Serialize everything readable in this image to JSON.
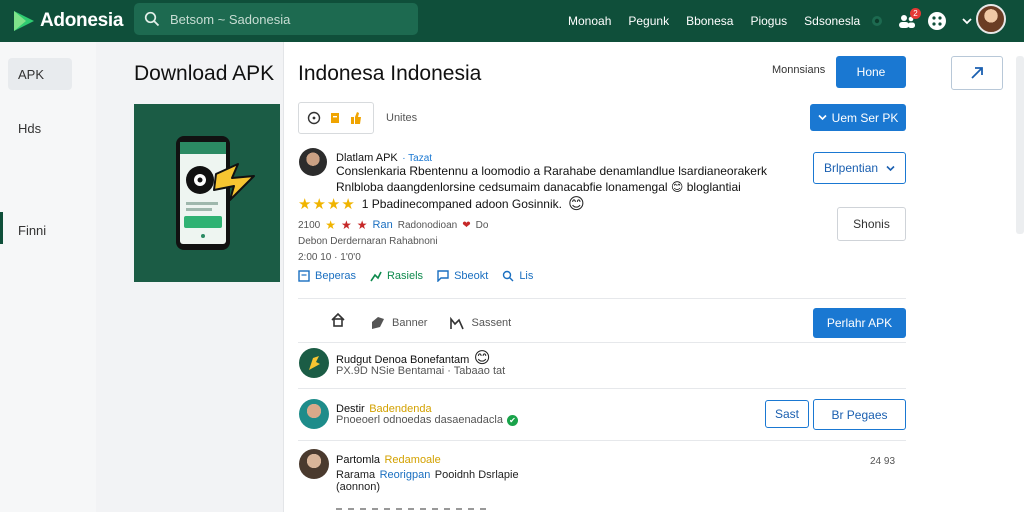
{
  "brand": {
    "name": "Adonesia"
  },
  "search": {
    "placeholder": "Betsom ~ Sadonesia"
  },
  "nav": {
    "links": [
      "Monoah",
      "Pegunk",
      "Bbonesa",
      "Piogus",
      "Sdsonesla"
    ]
  },
  "notifications": {
    "count": "2"
  },
  "rail": {
    "items": [
      "APK",
      "Hds",
      "Finni"
    ]
  },
  "download": {
    "title": "Download APK"
  },
  "panel": {
    "title": "Indonesa Indonesia",
    "header_label": "Monnsians",
    "header_button": "Hone",
    "toolbar_label": "Unites",
    "user_set_button": "Uem Ser PK"
  },
  "app_post": {
    "name": "Dlatlam APK",
    "tag": "Tazat",
    "line1": "Conslenkaria Rbentennu a loomodio a Rarahabe denamlandlue lsardianeorakerk",
    "line2": "Rnlbloba daangdenlorsine cedsumaim danacabfie lonamengal",
    "line2_emoji": "😊 ",
    "line2_tail": "bloglantiai",
    "rating_text": "1 Pbadinecompaned adoon Gosinnik.",
    "rating_emoji": "😊",
    "stats_line": "2100",
    "stats_label": "Ran",
    "stats_extra": "Radonodioan",
    "stats_tail": "Do",
    "meta1": "Debon Derdernaran Rahabnoni",
    "meta2": "2:00 10 · 1'0'0",
    "actions": [
      "Beperas",
      "Rasiels",
      "Sbeokt",
      "Lis"
    ],
    "dropdown": "Brlpentian",
    "side_button": "Shonis"
  },
  "action_bar": {
    "items": [
      "Banner",
      "Sassent"
    ],
    "primary": "Perlahr APK"
  },
  "comments": [
    {
      "name": "Rudgut Denoa Bonefantam",
      "emoji": "😊",
      "sub": "PX.9D NSie Bentamai · Tabaao tat"
    },
    {
      "name": "Destir",
      "tag": "Badendenda",
      "sub": "Pnoeoerl odnoedas dasaenadacla",
      "sub_emoji": "✔",
      "btn1": "Sast",
      "btn2": "Br Pegaes"
    },
    {
      "name": "Partomla",
      "tag": "Redamoale",
      "sub1": "Rarama",
      "sub1_tag": "Reorigpan",
      "sub1_tail": "Pooidnh Dsrlapie",
      "sub2": "(aonnon)",
      "time": "24 93"
    }
  ],
  "colors": {
    "topbar": "#0f4f3a",
    "accent": "#1a78d2",
    "star": "#f0b400",
    "card": "#1b5c45"
  }
}
